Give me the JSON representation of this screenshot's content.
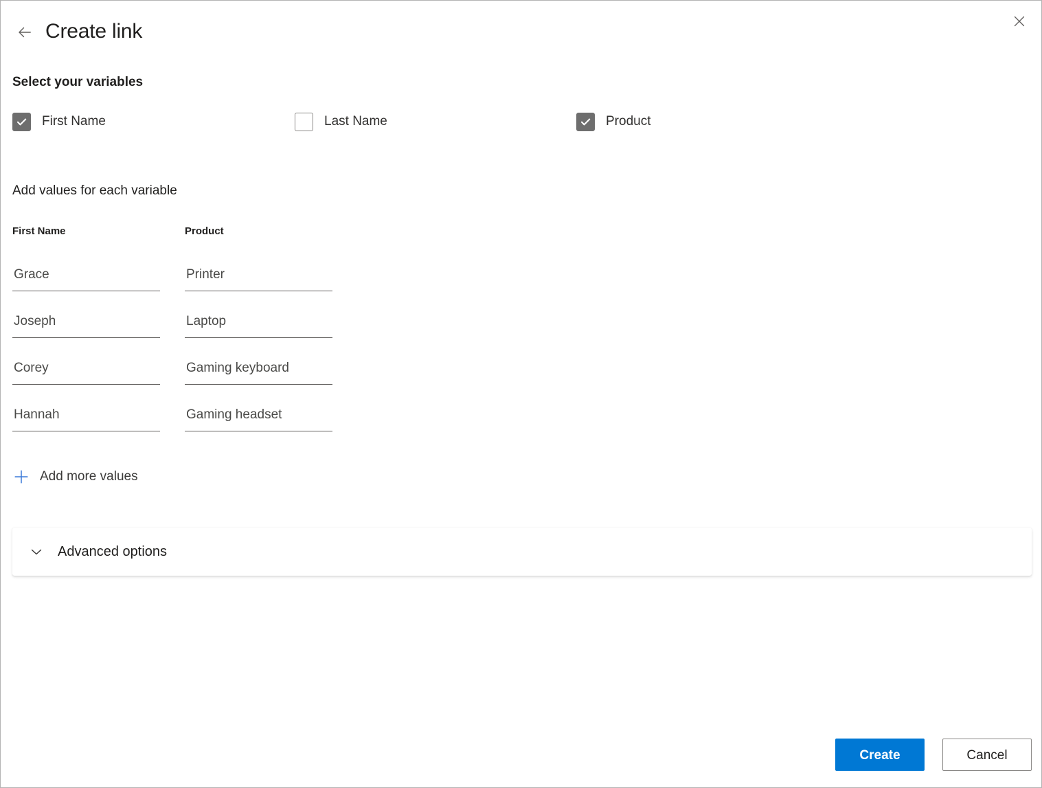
{
  "dialog": {
    "title": "Create link",
    "back_icon": "arrow-left-icon",
    "close_icon": "close-icon"
  },
  "select_variables": {
    "heading": "Select your variables",
    "options": [
      {
        "label": "First Name",
        "checked": true
      },
      {
        "label": "Last Name",
        "checked": false
      },
      {
        "label": "Product",
        "checked": true
      }
    ]
  },
  "add_values": {
    "heading": "Add values for each variable",
    "columns": [
      {
        "header": "First Name",
        "values": [
          "Grace",
          "Joseph",
          "Corey",
          "Hannah"
        ]
      },
      {
        "header": "Product",
        "values": [
          "Printer",
          "Laptop",
          "Gaming keyboard",
          "Gaming headset"
        ]
      }
    ],
    "add_more_label": "Add more values",
    "add_more_icon": "plus-icon"
  },
  "advanced": {
    "label": "Advanced options",
    "icon": "chevron-down-icon",
    "expanded": false
  },
  "footer": {
    "create_label": "Create",
    "cancel_label": "Cancel"
  },
  "colors": {
    "accent": "#0078d4",
    "checkbox_fill": "#6e6e6e",
    "text": "#201f1e",
    "border": "#8a8886"
  }
}
